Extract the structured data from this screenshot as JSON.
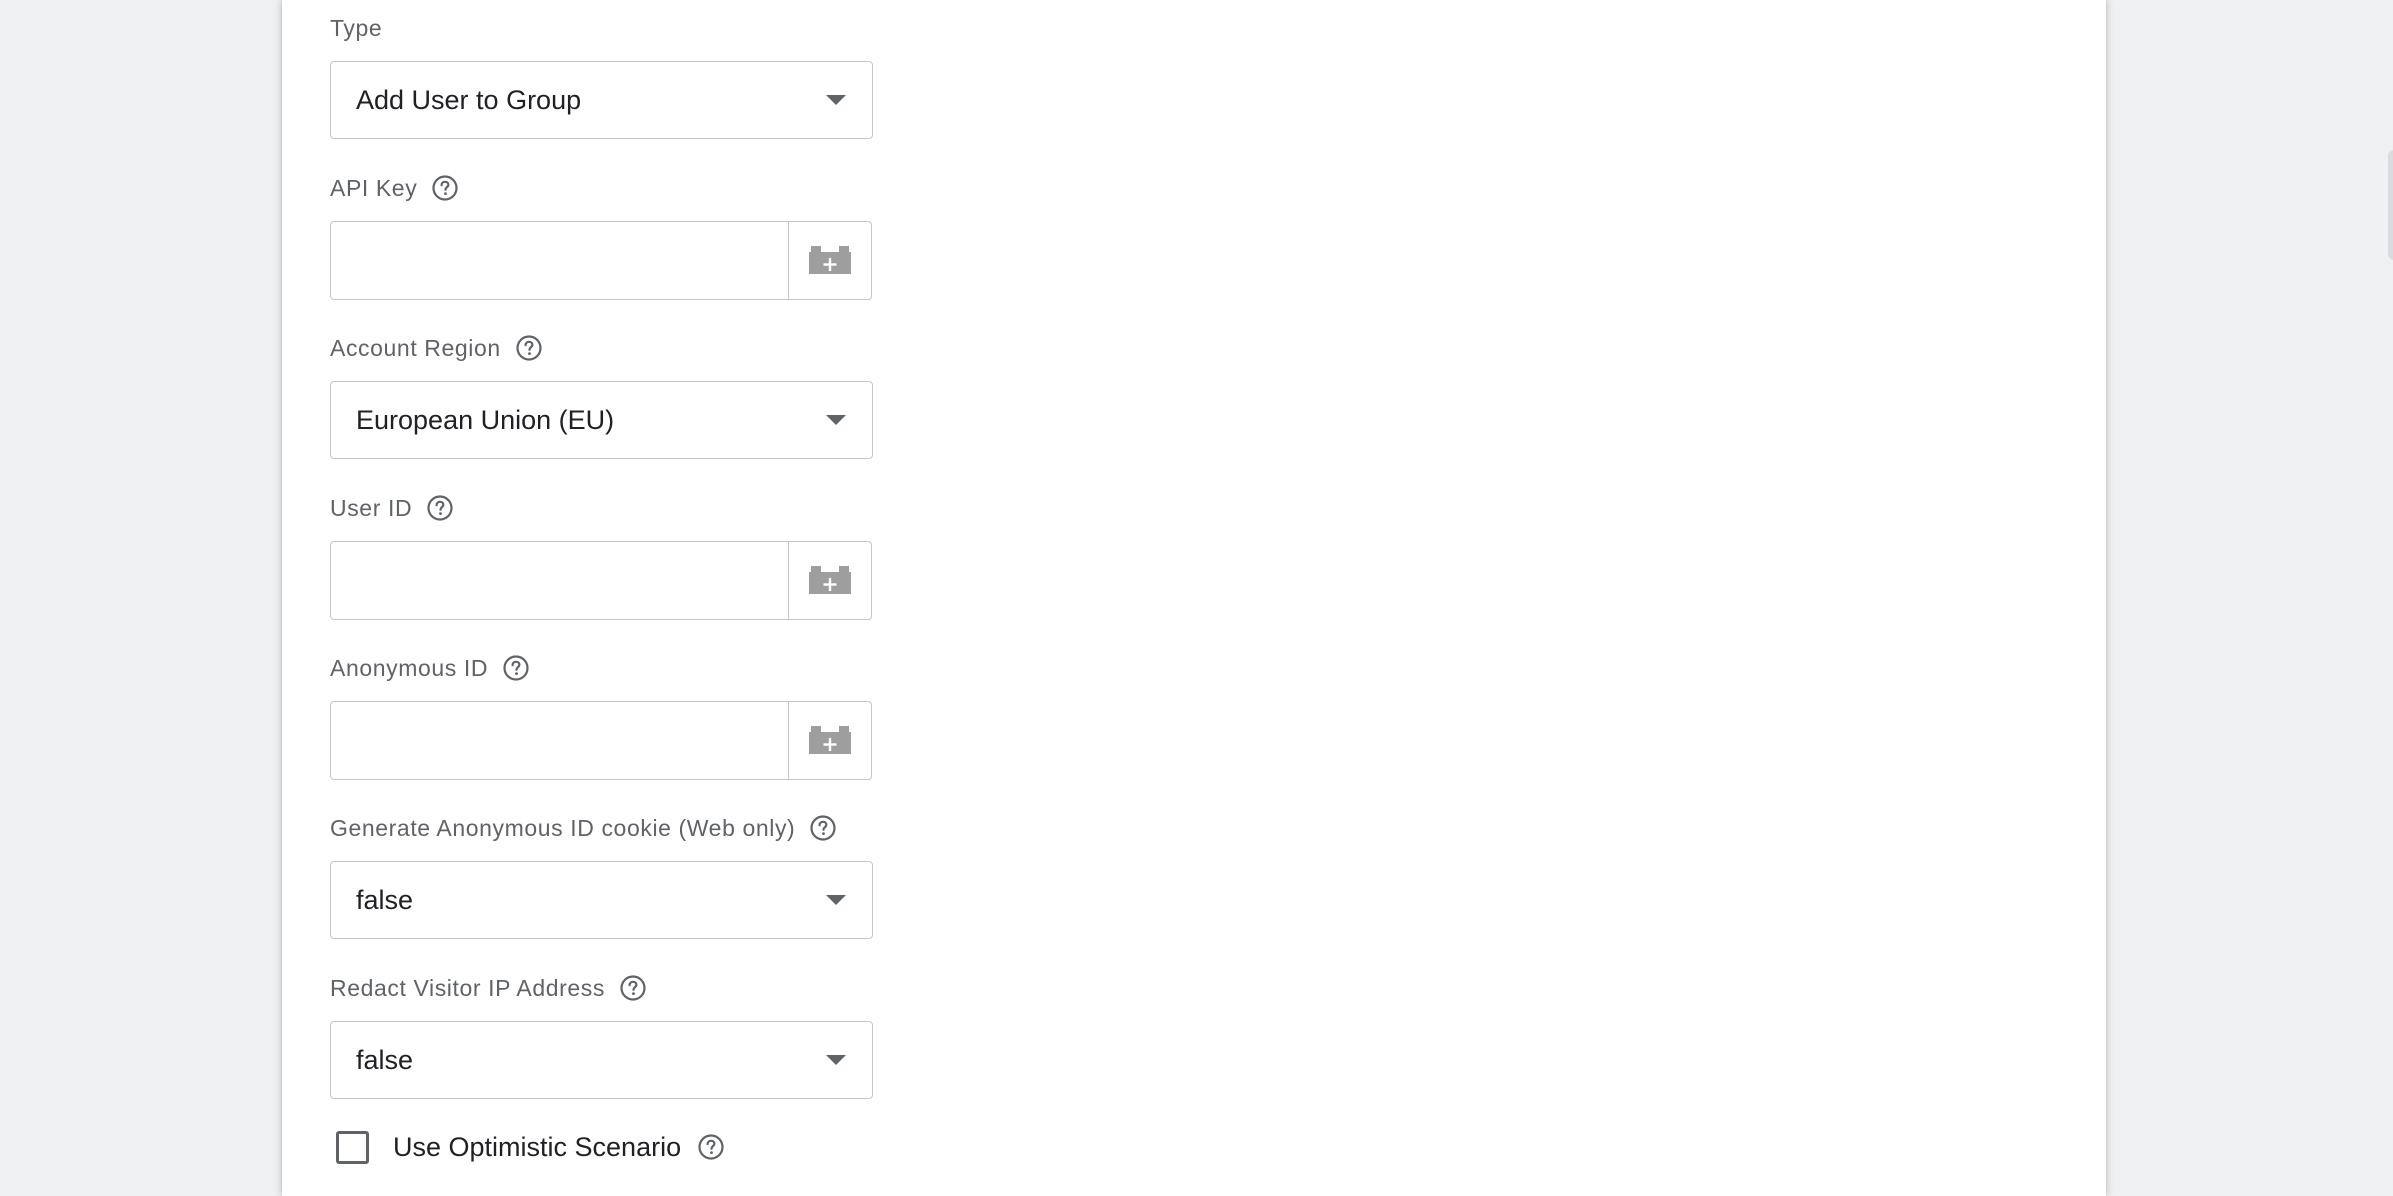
{
  "form": {
    "type": {
      "label": "Type",
      "value": "Add User to Group"
    },
    "api_key": {
      "label": "API Key",
      "value": ""
    },
    "account_region": {
      "label": "Account Region",
      "value": "European Union (EU)"
    },
    "user_id": {
      "label": "User ID",
      "value": ""
    },
    "anonymous_id": {
      "label": "Anonymous ID",
      "value": ""
    },
    "generate_anonymous_cookie": {
      "label": "Generate Anonymous ID cookie (Web only)",
      "value": "false"
    },
    "redact_ip": {
      "label": "Redact Visitor IP Address",
      "value": "false"
    },
    "optimistic_scenario": {
      "label": "Use Optimistic Scenario",
      "checked": false
    }
  },
  "icons": {
    "help": "help-circle-icon",
    "variable": "variable-brick-icon",
    "dropdown": "caret-down-icon"
  },
  "colors": {
    "label": "#5f6368",
    "text": "#202124",
    "border": "#c6c6c6",
    "icon_gray": "#9e9e9e",
    "background": "#eef0f2"
  }
}
